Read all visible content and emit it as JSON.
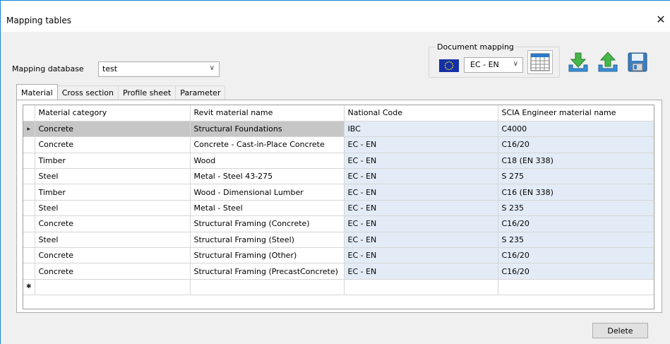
{
  "window": {
    "title": "Mapping tables",
    "close_glyph": "✕"
  },
  "database": {
    "label": "Mapping database",
    "value": "test",
    "chevron": "∨"
  },
  "document_mapping": {
    "label": "Document mapping",
    "flag_icon": "eu-flag-icon",
    "value": "EC - EN",
    "chevron": "∨",
    "buttons": [
      "grid-icon",
      "import-icon",
      "export-icon",
      "save-icon"
    ]
  },
  "tabs": [
    "Material",
    "Cross section",
    "Profile sheet",
    "Parameter"
  ],
  "table": {
    "columns": [
      "Material category",
      "Revit material name",
      "National Code",
      "SCIA Engineer material name"
    ],
    "rows": [
      [
        "Concrete",
        "Structural Foundations",
        "IBC",
        "C4000"
      ],
      [
        "Concrete",
        "Concrete - Cast-in-Place Concrete",
        "EC - EN",
        "C16/20"
      ],
      [
        "Timber",
        "Wood",
        "EC - EN",
        "C18 (EN 338)"
      ],
      [
        "Steel",
        "Metal - Steel 43-275",
        "EC - EN",
        "S 275"
      ],
      [
        "Timber",
        "Wood - Dimensional Lumber",
        "EC - EN",
        "C16 (EN 338)"
      ],
      [
        "Steel",
        "Metal - Steel",
        "EC - EN",
        "S 235"
      ],
      [
        "Concrete",
        "Structural Framing (Concrete)",
        "EC - EN",
        "C16/20"
      ],
      [
        "Steel",
        "Structural Framing (Steel)",
        "EC - EN",
        "S 235"
      ],
      [
        "Concrete",
        "Structural Framing (Other)",
        "EC - EN",
        "C16/20"
      ],
      [
        "Concrete",
        "Structural Framing (PrecastConcrete)",
        "EC - EN",
        "C16/20"
      ]
    ],
    "current_row_marker": "▸",
    "new_row_marker": "✱"
  },
  "footer": {
    "delete_label": "Delete"
  },
  "colors": {
    "accent_border": "#1883d7",
    "selected_row": "#c6c6c6",
    "readonly_cell": "#e3ecf6"
  }
}
